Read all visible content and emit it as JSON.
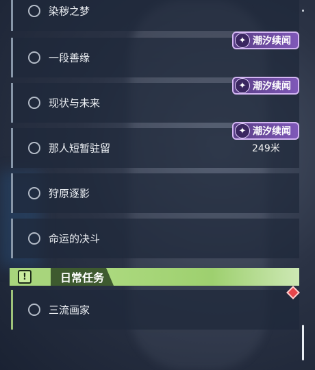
{
  "quests": [
    {
      "label": "染秽之梦"
    },
    {
      "label": "一段善缘"
    },
    {
      "label": "现状与未来"
    },
    {
      "label": "那人短暂驻留"
    },
    {
      "label": "狩原逐影"
    },
    {
      "label": "命运的决斗"
    }
  ],
  "badges": [
    {
      "text": "潮汐续闻"
    },
    {
      "text": "潮汐续闻"
    },
    {
      "text": "潮汐续闻"
    }
  ],
  "distance": "249米",
  "daily_section": {
    "icon": "!",
    "title": "日常任务"
  },
  "daily_quests": [
    {
      "label": "三流画家"
    }
  ],
  "colors": {
    "badge_purple": "#7f58b8",
    "daily_green": "#9ed06f",
    "marker_red": "#e8464c"
  },
  "icons": {
    "quest_status": "circle-outline-icon",
    "badge": "tide-sparkle-icon",
    "section": "exclamation-box-icon",
    "marker": "diamond-marker-icon"
  }
}
